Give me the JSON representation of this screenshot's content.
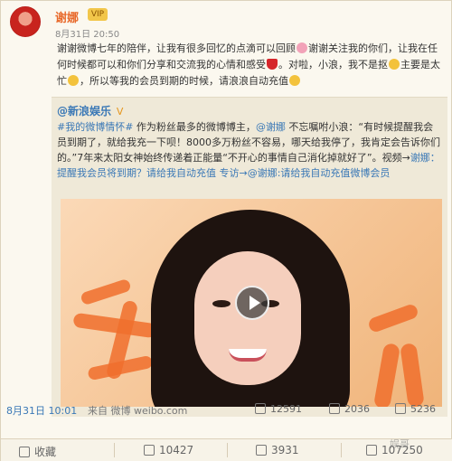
{
  "post": {
    "author": "谢娜",
    "badge": "VIP",
    "meta": "8月31日 20:50",
    "text_part1": "谢谢微博七年的陪伴，让我有很多回忆的点滴可以回顾",
    "text_part2": "谢谢关注我的你们，让我在任何时候都可以和你们分享和交流我的心情和感受",
    "text_part3": "。对啦，小浪，我不是抠",
    "text_part4": "主要是太忙",
    "text_part5": "，所以等我的会员到期的时候，请浪浪自动充值",
    "emoji_pig": "pig-emoji",
    "emoji_heart": "heart-emoji",
    "emoji_smile": "laugh-emoji"
  },
  "repost": {
    "author": "@新浪娱乐",
    "v": "V",
    "text_start": "#我的微博情怀#",
    "text_main1": " 作为粉丝最多的微博博主，",
    "mention": "@谢娜",
    "text_main2": " 不忘嘱咐小浪：“有时候提醒我会员到期了，就给我充一下呗！",
    "text_main3": "8000多万粉丝不容易，哪天给我停了，我肯定会告诉你们的。”7年来太阳女神始终传递着正能量“不开心的事情自己消化掉就好了”。视频→",
    "video_link": "谢娜：提醒我会员将到期？请给我自动充值 专访→",
    "tail_link": "@谢娜:请给我自动充值微博会员",
    "date": "8月31日 10:01",
    "source": "来自 微博 weibo.com",
    "repost_count": "12591",
    "comment_count": "2036",
    "like_count": "5236"
  },
  "actions": {
    "collect": "收藏",
    "repost": "10427",
    "comment": "3931",
    "like": "107250"
  },
  "watermark": "娱哥",
  "colors": {
    "author": "#e8692a",
    "link": "#3a78b6",
    "background": "#fbf8ef",
    "accent": "#f06f2d"
  }
}
